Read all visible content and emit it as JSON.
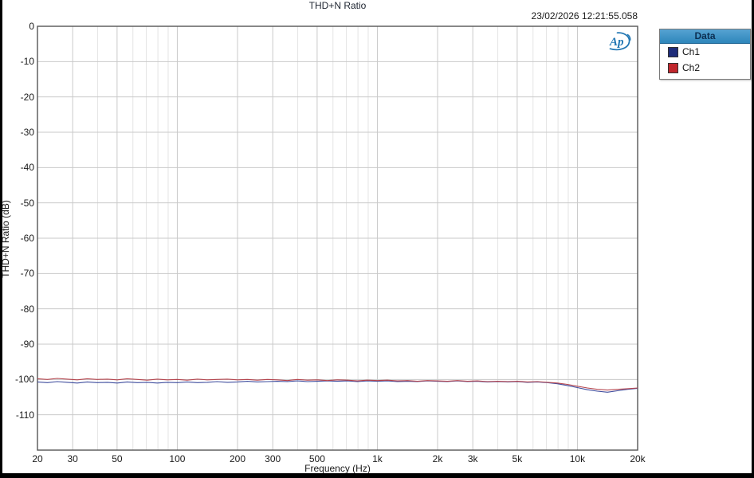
{
  "header": {
    "title": "THD+N Ratio",
    "timestamp": "23/02/2026 12:21:55.058"
  },
  "logo": {
    "name": "Audio Precision",
    "short": "Ap",
    "color": "#2176b3"
  },
  "legend": {
    "header": "Data",
    "items": [
      {
        "label": "Ch1",
        "swatch_color": "#1f2d7a"
      },
      {
        "label": "Ch2",
        "swatch_color": "#c1272d"
      }
    ]
  },
  "colors": {
    "grid_major": "#c9c9c9",
    "grid_minor": "#e4e4e4",
    "frame": "#555555",
    "ch1_line": "#3f4d9e",
    "ch2_line": "#b5454e",
    "legend_header_bg": "#2e86bb"
  },
  "chart_data": {
    "type": "line",
    "title": "THD+N Ratio",
    "xlabel": "Frequency (Hz)",
    "ylabel": "THD+N Ratio (dB)",
    "x_scale": "log",
    "xlim": [
      20,
      20000
    ],
    "ylim": [
      -120,
      0
    ],
    "grid": true,
    "legend_position": "outside-top-right",
    "y_ticks": [
      {
        "value": 0,
        "label": "0"
      },
      {
        "value": -10,
        "label": "-10"
      },
      {
        "value": -20,
        "label": "-20"
      },
      {
        "value": -30,
        "label": "-30"
      },
      {
        "value": -40,
        "label": "-40"
      },
      {
        "value": -50,
        "label": "-50"
      },
      {
        "value": -60,
        "label": "-60"
      },
      {
        "value": -70,
        "label": "-70"
      },
      {
        "value": -80,
        "label": "-80"
      },
      {
        "value": -90,
        "label": "-90"
      },
      {
        "value": -100,
        "label": "-100"
      },
      {
        "value": -110,
        "label": "-110"
      }
    ],
    "x_major_ticks": [
      {
        "value": 20,
        "label": "20"
      },
      {
        "value": 30,
        "label": "30"
      },
      {
        "value": 50,
        "label": "50"
      },
      {
        "value": 100,
        "label": "100"
      },
      {
        "value": 200,
        "label": "200"
      },
      {
        "value": 300,
        "label": "300"
      },
      {
        "value": 500,
        "label": "500"
      },
      {
        "value": 1000,
        "label": "1k"
      },
      {
        "value": 2000,
        "label": "2k"
      },
      {
        "value": 3000,
        "label": "3k"
      },
      {
        "value": 5000,
        "label": "5k"
      },
      {
        "value": 10000,
        "label": "10k"
      },
      {
        "value": 20000,
        "label": "20k"
      }
    ],
    "x_minor_ticks": [
      40,
      60,
      70,
      80,
      90,
      400,
      600,
      700,
      800,
      900,
      4000,
      6000,
      7000,
      8000,
      9000
    ],
    "series": [
      {
        "name": "Ch1",
        "color": "#3f4d9e",
        "points": [
          [
            20,
            -100.7
          ],
          [
            22.4,
            -100.9
          ],
          [
            25.1,
            -100.6
          ],
          [
            28.2,
            -100.8
          ],
          [
            31.6,
            -101.0
          ],
          [
            35.5,
            -100.7
          ],
          [
            39.8,
            -100.9
          ],
          [
            44.7,
            -100.8
          ],
          [
            50.1,
            -101.0
          ],
          [
            56.2,
            -100.7
          ],
          [
            63.1,
            -100.9
          ],
          [
            70.8,
            -100.8
          ],
          [
            79.4,
            -101.0
          ],
          [
            89.1,
            -100.8
          ],
          [
            100,
            -100.9
          ],
          [
            112,
            -100.7
          ],
          [
            126,
            -100.9
          ],
          [
            141,
            -100.8
          ],
          [
            158,
            -100.6
          ],
          [
            178,
            -100.8
          ],
          [
            200,
            -100.7
          ],
          [
            224,
            -100.5
          ],
          [
            251,
            -100.7
          ],
          [
            282,
            -100.6
          ],
          [
            316,
            -100.5
          ],
          [
            355,
            -100.6
          ],
          [
            398,
            -100.4
          ],
          [
            447,
            -100.6
          ],
          [
            501,
            -100.5
          ],
          [
            562,
            -100.4
          ],
          [
            631,
            -100.5
          ],
          [
            708,
            -100.4
          ],
          [
            794,
            -100.6
          ],
          [
            891,
            -100.4
          ],
          [
            1000,
            -100.5
          ],
          [
            1122,
            -100.4
          ],
          [
            1259,
            -100.6
          ],
          [
            1413,
            -100.5
          ],
          [
            1585,
            -100.6
          ],
          [
            1778,
            -100.4
          ],
          [
            1995,
            -100.5
          ],
          [
            2239,
            -100.6
          ],
          [
            2512,
            -100.4
          ],
          [
            2818,
            -100.6
          ],
          [
            3162,
            -100.5
          ],
          [
            3548,
            -100.7
          ],
          [
            3981,
            -100.6
          ],
          [
            4467,
            -100.7
          ],
          [
            5012,
            -100.6
          ],
          [
            5623,
            -100.8
          ],
          [
            6310,
            -100.7
          ],
          [
            7079,
            -100.9
          ],
          [
            7943,
            -101.2
          ],
          [
            8913,
            -101.7
          ],
          [
            10000,
            -102.3
          ],
          [
            11220,
            -102.9
          ],
          [
            12589,
            -103.3
          ],
          [
            14125,
            -103.6
          ],
          [
            15849,
            -103.2
          ],
          [
            17783,
            -102.8
          ],
          [
            20000,
            -102.5
          ]
        ]
      },
      {
        "name": "Ch2",
        "color": "#b5454e",
        "points": [
          [
            20,
            -99.8
          ],
          [
            22.4,
            -100.0
          ],
          [
            25.1,
            -99.7
          ],
          [
            28.2,
            -99.9
          ],
          [
            31.6,
            -100.1
          ],
          [
            35.5,
            -99.8
          ],
          [
            39.8,
            -100.0
          ],
          [
            44.7,
            -99.9
          ],
          [
            50.1,
            -100.1
          ],
          [
            56.2,
            -99.8
          ],
          [
            63.1,
            -100.0
          ],
          [
            70.8,
            -100.2
          ],
          [
            79.4,
            -99.9
          ],
          [
            89.1,
            -100.1
          ],
          [
            100,
            -100.0
          ],
          [
            112,
            -100.2
          ],
          [
            126,
            -99.9
          ],
          [
            141,
            -100.1
          ],
          [
            158,
            -100.0
          ],
          [
            178,
            -99.9
          ],
          [
            200,
            -100.1
          ],
          [
            224,
            -100.0
          ],
          [
            251,
            -100.2
          ],
          [
            282,
            -100.0
          ],
          [
            316,
            -100.1
          ],
          [
            355,
            -100.3
          ],
          [
            398,
            -100.0
          ],
          [
            447,
            -100.2
          ],
          [
            501,
            -100.1
          ],
          [
            562,
            -100.3
          ],
          [
            631,
            -100.1
          ],
          [
            708,
            -100.2
          ],
          [
            794,
            -100.4
          ],
          [
            891,
            -100.2
          ],
          [
            1000,
            -100.3
          ],
          [
            1122,
            -100.2
          ],
          [
            1259,
            -100.4
          ],
          [
            1413,
            -100.3
          ],
          [
            1585,
            -100.5
          ],
          [
            1778,
            -100.3
          ],
          [
            1995,
            -100.4
          ],
          [
            2239,
            -100.5
          ],
          [
            2512,
            -100.3
          ],
          [
            2818,
            -100.5
          ],
          [
            3162,
            -100.4
          ],
          [
            3548,
            -100.6
          ],
          [
            3981,
            -100.5
          ],
          [
            4467,
            -100.6
          ],
          [
            5012,
            -100.5
          ],
          [
            5623,
            -100.7
          ],
          [
            6310,
            -100.6
          ],
          [
            7079,
            -100.8
          ],
          [
            7943,
            -101.0
          ],
          [
            8913,
            -101.4
          ],
          [
            10000,
            -101.9
          ],
          [
            11220,
            -102.4
          ],
          [
            12589,
            -102.8
          ],
          [
            14125,
            -103.0
          ],
          [
            15849,
            -102.8
          ],
          [
            17783,
            -102.6
          ],
          [
            20000,
            -102.4
          ]
        ]
      }
    ]
  }
}
